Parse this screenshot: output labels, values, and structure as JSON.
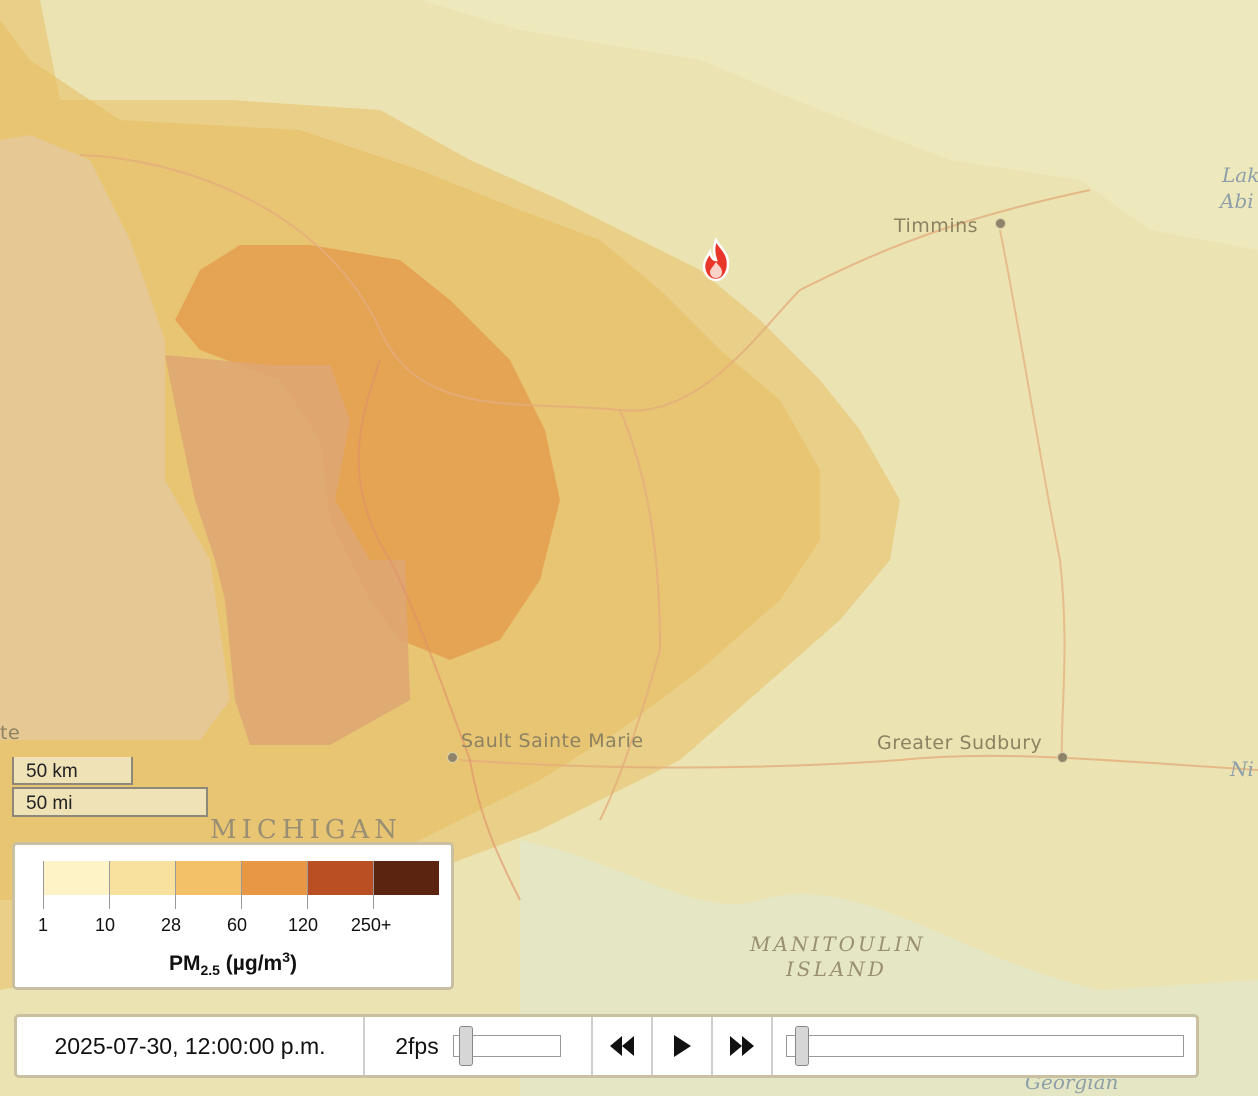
{
  "map": {
    "places": [
      {
        "name": "Timmins",
        "kind": "city"
      },
      {
        "name": "Sault Sainte Marie",
        "kind": "city"
      },
      {
        "name": "Greater Sudbury",
        "kind": "city"
      }
    ],
    "regions": [
      "MICHIGAN",
      "MANITOULIN",
      "ISLAND"
    ],
    "partial_labels": [
      "te",
      "Lak",
      "Abi",
      "Ni",
      "Georgian"
    ],
    "fire_marker": "fire-icon"
  },
  "scale": {
    "km_label": "50 km",
    "mi_label": "50 mi"
  },
  "legend": {
    "colors": [
      "#fdf3c6",
      "#f8e19e",
      "#f3c167",
      "#e89744",
      "#b94f22",
      "#5a2410"
    ],
    "ticks": [
      "1",
      "10",
      "28",
      "60",
      "120",
      "250+"
    ],
    "title_main": "PM",
    "title_sub": "2.5",
    "title_unit": " (µg/m",
    "title_sup": "3",
    "title_end": ")"
  },
  "controls": {
    "timestamp": "2025-07-30, 12:00:00 p.m.",
    "fps_label": "2fps",
    "fps_slider_value": 0.05,
    "time_slider_value": 0.02,
    "rewind_icon": "rewind-icon",
    "play_icon": "play-icon",
    "forward_icon": "fast-forward-icon"
  }
}
